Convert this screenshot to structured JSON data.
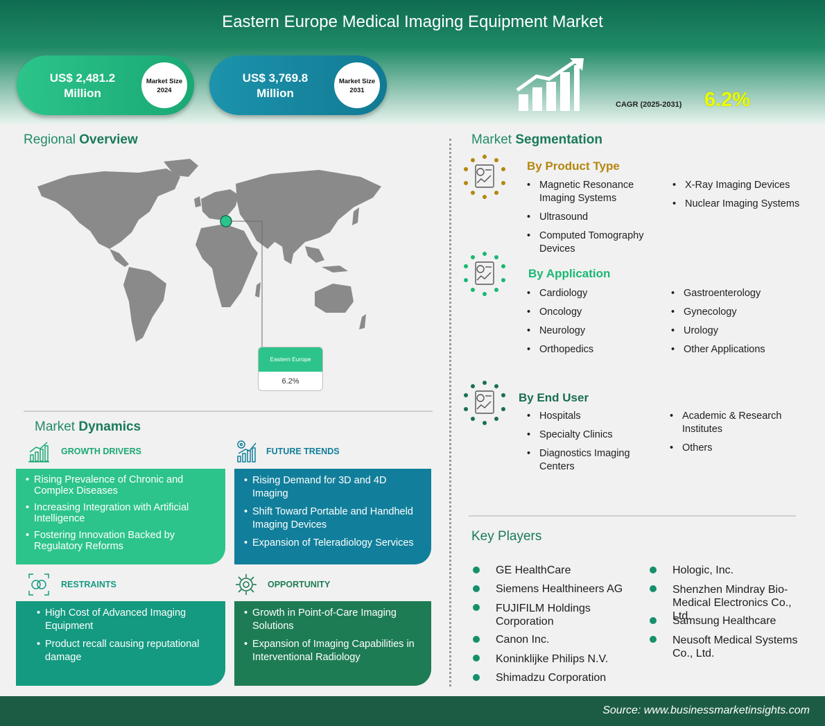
{
  "title": "Eastern Europe Medical Imaging Equipment Market",
  "market_size": [
    {
      "value": "US$ 2,481.2",
      "unit": "Million",
      "label": "Market Size",
      "year": "2024",
      "color": "#2cc48a"
    },
    {
      "value": "US$ 3,769.8",
      "unit": "Million",
      "label": "Market Size",
      "year": "2031",
      "color": "#117a93"
    }
  ],
  "cagr": {
    "label": "CAGR (2025-2031)",
    "value": "6.2%",
    "color": "#eaff00"
  },
  "regional": {
    "heading_a": "Regional ",
    "heading_b": "Overview",
    "region": "Eastern Europe",
    "value": "6.2%"
  },
  "dynamics": {
    "heading_a": "Market ",
    "heading_b": "Dynamics",
    "drivers": {
      "title": "GROWTH DRIVERS",
      "icon": "growth-chart-icon",
      "items": [
        "Rising Prevalence of Chronic and Complex Diseases",
        "Increasing Integration with Artificial Intelligence",
        "Fostering Innovation Backed by Regulatory Reforms"
      ]
    },
    "trends": {
      "title": "FUTURE TRENDS",
      "icon": "trends-icon",
      "items": [
        "Rising Demand for 3D and 4D Imaging",
        "Shift Toward Portable and Handheld Imaging Devices",
        "Expansion of Teleradiology Services"
      ]
    },
    "restraints": {
      "title": "RESTRAINTS",
      "icon": "restraint-icon",
      "items": [
        "High Cost of Advanced Imaging Equipment",
        "Product recall causing reputational damage"
      ]
    },
    "opportunity": {
      "title": "OPPORTUNITY",
      "icon": "gear-icon",
      "items": [
        "Growth in Point-of-Care Imaging Solutions",
        "Expansion of Imaging Capabilities in Interventional Radiology"
      ]
    }
  },
  "segmentation": {
    "heading_a": "Market ",
    "heading_b": "Segmentation",
    "product_type": {
      "title": "By Product Type",
      "color": "#b5860e",
      "left": [
        "Magnetic Resonance Imaging Systems",
        "Ultrasound",
        "Computed Tomography Devices"
      ],
      "right": [
        "X-Ray Imaging Devices",
        "Nuclear Imaging Systems"
      ]
    },
    "application": {
      "title": "By Application",
      "color": "#19b873",
      "left": [
        "Cardiology",
        "Oncology",
        "Neurology",
        "Orthopedics"
      ],
      "right": [
        "Gastroenterology",
        "Gynecology",
        "Urology",
        "Other Applications"
      ]
    },
    "end_user": {
      "title": "By End User",
      "color": "#1a6e55",
      "left": [
        "Hospitals",
        "Specialty Clinics",
        "Diagnostics Imaging Centers"
      ],
      "right": [
        "Academic & Research Institutes",
        "Others"
      ]
    }
  },
  "key_players": {
    "heading": "Key Players",
    "left": [
      "GE HealthCare",
      "Siemens Healthineers AG",
      "FUJIFILM Holdings Corporation",
      "Canon Inc.",
      "Koninklijke Philips N.V.",
      "Shimadzu Corporation"
    ],
    "right": [
      "Hologic, Inc.",
      "Shenzhen Mindray Bio-Medical Electronics Co., Ltd.",
      "Samsung Healthcare",
      "Neusoft Medical Systems Co., Ltd."
    ]
  },
  "source": "Source: www.businessmarketinsights.com"
}
